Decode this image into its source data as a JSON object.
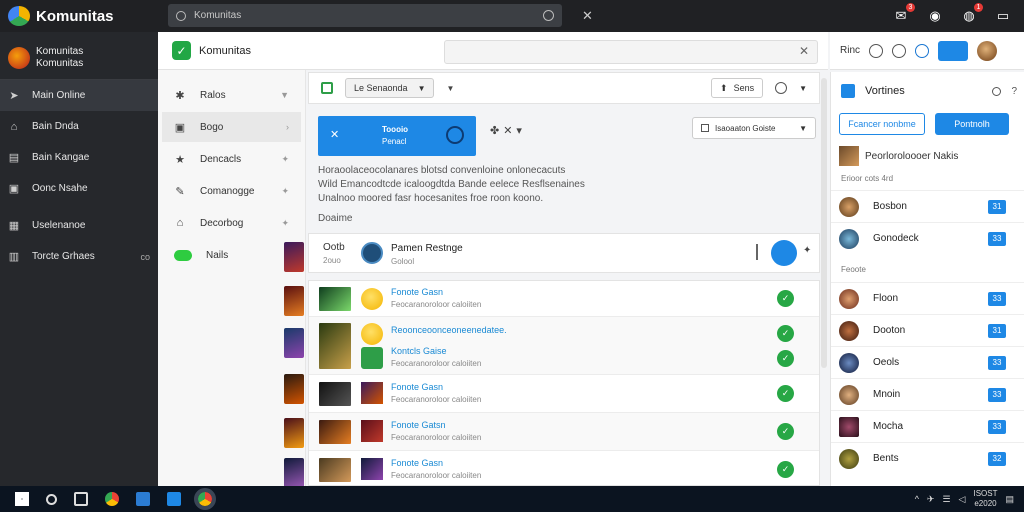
{
  "app": {
    "name": "Komunitas"
  },
  "search": {
    "placeholder": "Komunitas"
  },
  "topbar": {
    "badge1": "3",
    "badge2": "1"
  },
  "sidebar": {
    "profile_name": "Komunitas",
    "profile_sub": "Komunitas",
    "items": [
      {
        "label": "Main Online",
        "icon": "arrow-icon"
      },
      {
        "label": "Bain Dnda",
        "icon": "home-icon"
      },
      {
        "label": "Bain Kangae",
        "icon": "doc-icon"
      },
      {
        "label": "Oonc Nsahe",
        "icon": "monitor-icon"
      },
      {
        "label": "Uselenanoe",
        "icon": "grid-icon"
      },
      {
        "label": "Torcte Grhaes",
        "icon": "chart-icon",
        "extra": "co"
      }
    ]
  },
  "header": {
    "title": "Komunitas"
  },
  "rheader": {
    "label": "Rinc"
  },
  "nav2": {
    "items": [
      {
        "label": "Ralos"
      },
      {
        "label": "Bogo"
      },
      {
        "label": "Dencacls"
      },
      {
        "label": "Comanogge"
      },
      {
        "label": "Decorbog"
      },
      {
        "label": "Nails"
      }
    ]
  },
  "toolbar": {
    "select": "Le Senaonda",
    "right_label": "Sens"
  },
  "action": {
    "btn_line1": "Toooio",
    "btn_line2": "Penacl",
    "filter": "Isaoaaton Goiste"
  },
  "content": {
    "desc_line1": "Horaoolaceocolanares blotsd convenloine onlonecacuts",
    "desc_line2": "Wild Emancodtcde icaloogdtda Bande eelece Resflsenaines",
    "desc_line3": "Unalnoo moored fasr hocesanites froe roon koono.",
    "section": "Doaime"
  },
  "card": {
    "label": "Ootb",
    "label_sub": "2ouo",
    "name": "Pamen Restnge",
    "name_sub": "Golool"
  },
  "list": [
    {
      "title": "Fonote Gasn",
      "sub": "Feocaranoroloor caloiiten"
    },
    {
      "title": "Reoonceoonceoneenedatee.",
      "sub": ""
    },
    {
      "title": "Kontcls Gaise",
      "sub": "Feocaranoroloor caloiiten"
    },
    {
      "title": "Fonote Gasn",
      "sub": "Feocaranoroloor caloiiten"
    },
    {
      "title": "Fonote Gatsn",
      "sub": "Feocaranoroloor caloiiten"
    },
    {
      "title": "Fonote Gasn",
      "sub": "Feocaranoroloor caloiiten"
    }
  ],
  "rpanel": {
    "title": "Vortines",
    "btn1": "Fcancer nonbme",
    "btn2": "Pontnolh",
    "feat": "Peorloroloooer Nakis",
    "small1": "Erioor cots 4rd",
    "small2": "Feoote",
    "rows": [
      {
        "name": "Bosbon",
        "badge": "31"
      },
      {
        "name": "Gonodeck",
        "badge": "33"
      },
      {
        "name": "Floon",
        "badge": "33"
      },
      {
        "name": "Dooton",
        "badge": "31"
      },
      {
        "name": "Oeols",
        "badge": "33"
      },
      {
        "name": "Mnoin",
        "badge": "33"
      },
      {
        "name": "Mocha",
        "badge": "33"
      },
      {
        "name": "Bents",
        "badge": "32"
      }
    ]
  },
  "taskbar": {
    "time": "ISOST",
    "date": "e2020"
  }
}
